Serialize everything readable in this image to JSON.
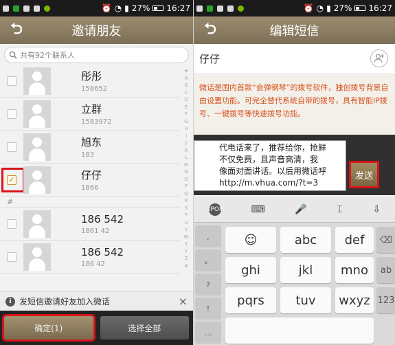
{
  "left": {
    "status": {
      "percent": "27%",
      "time": "16:27"
    },
    "title": "邀请朋友",
    "back_glyph": "⮌",
    "search_placeholder": "共有92个联系人",
    "contacts": [
      {
        "name": "彤彤",
        "phone": "158652",
        "checked": false
      },
      {
        "name": "立群",
        "phone": "1583972",
        "checked": false
      },
      {
        "name": "旭东",
        "phone": "183",
        "checked": false
      },
      {
        "name": "仔仔",
        "phone": "1866",
        "checked": true
      }
    ],
    "section_header": "#",
    "contacts2": [
      {
        "name": "186             542",
        "phone": "1861       42",
        "checked": false
      },
      {
        "name": "186             542",
        "phone": "186         42",
        "checked": false
      }
    ],
    "index_letters": [
      "★",
      "A",
      "B",
      "C",
      "D",
      "E",
      "F",
      "G",
      "H",
      "I",
      "J",
      "K",
      "L",
      "M",
      "N",
      "O",
      "P",
      "Q",
      "R",
      "S",
      "T",
      "U",
      "V",
      "W",
      "X",
      "Y",
      "Z",
      "#"
    ],
    "hint": "发短信邀请好友加入微话",
    "hint_close": "×",
    "confirm_label": "确定(1)",
    "select_all_label": "选择全部"
  },
  "right": {
    "status": {
      "percent": "27%",
      "time": "16:27"
    },
    "title": "编辑短信",
    "back_glyph": "⮌",
    "recipient": "仔仔",
    "description": "微话是国内首款“会弹钢琴”的拨号软件，独创拨号背景自由设置功能。可完全替代系统自带的拨号，具有智能IP拨号、一键拨号等快速拨号功能。",
    "message_lines": [
      "代电话来了，推荐给你，抢鲜",
      "不仅免费，且声音高清，我",
      "像面对面讲话。以后用微话呼",
      "http://m.vhua.com/?t=3"
    ],
    "send_label": "发送",
    "kb_toolbar": [
      "IPOP",
      "⌨",
      "🎤",
      "⌶",
      "⇩"
    ],
    "side_keys": [
      ",",
      "。",
      "?",
      "!",
      "..."
    ],
    "keys": {
      "emoji": "☺",
      "abc": "abc",
      "def": "def",
      "ghi": "ghi",
      "jkl": "jkl",
      "mno": "mno",
      "pqrs": "pqrs",
      "tuv": "tuv",
      "wxyz": "wxyz",
      "del": "⌫",
      "ab": "ab",
      "num": "123"
    }
  },
  "colors": {
    "title_bar": "#8c7d62",
    "accent_red": "#d8141a",
    "desc_text": "#d8501a"
  }
}
